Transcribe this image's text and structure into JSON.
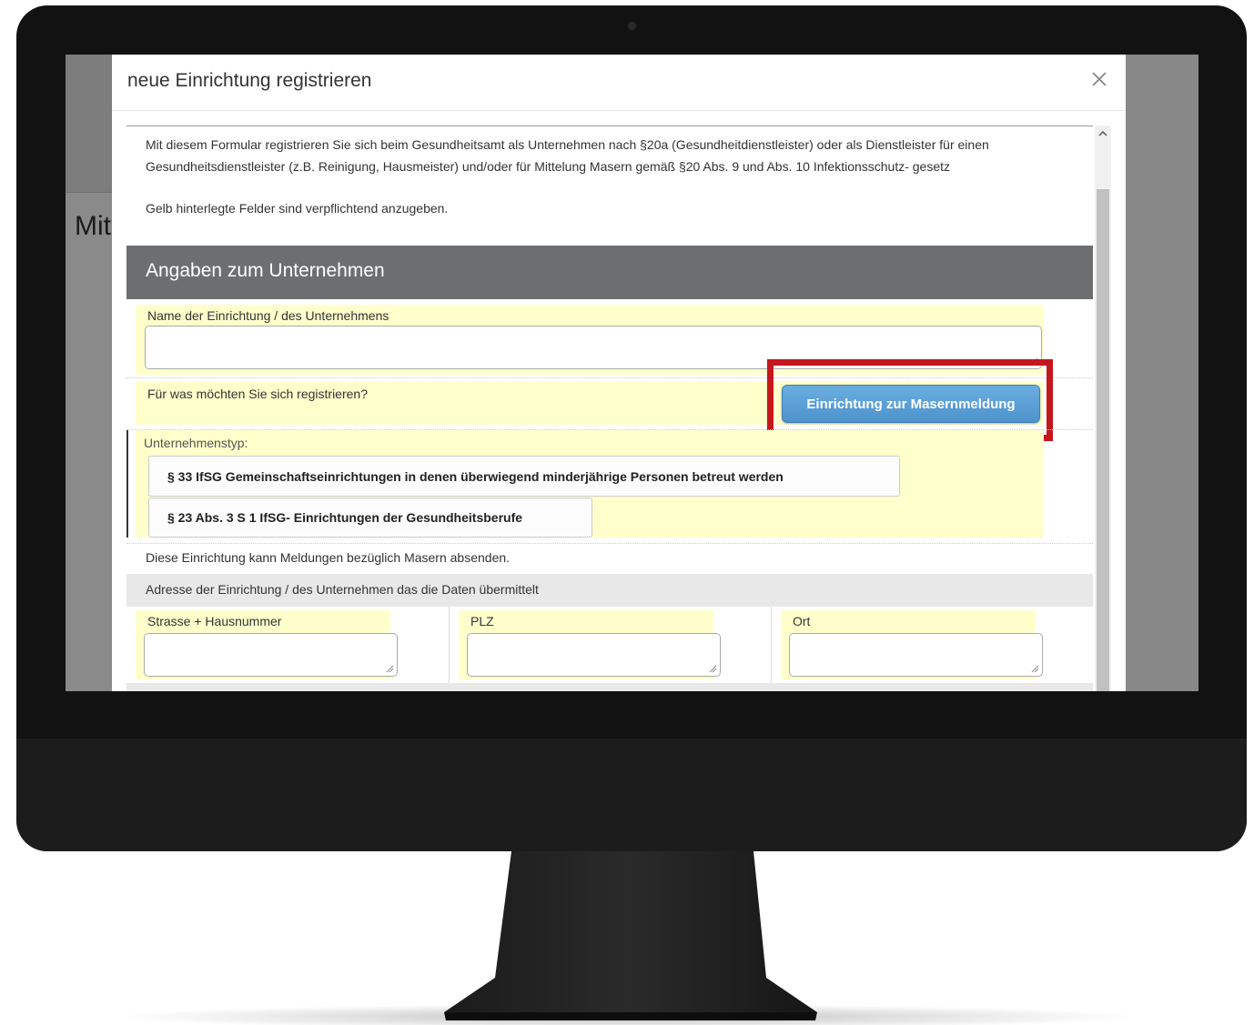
{
  "background_page": {
    "partial_title": "Mit"
  },
  "modal": {
    "title": "neue Einrichtung registrieren",
    "close_icon": "close-icon",
    "intro_text": "Mit diesem Formular registrieren Sie sich beim Gesundheitsamt als Unternehmen nach §20a (Gesundheitdienstleister) oder als Dienstleister für einen Gesundheitsdienstleister (z.B. Reinigung, Hausmeister) und/oder für Mittelung Masern gemäß §20 Abs. 9 und Abs. 10 Infektionsschutz- gesetz",
    "required_note": "Gelb hinterlegte Felder sind verpflichtend anzugeben.",
    "section_title": "Angaben zum Unternehmen",
    "name_label": "Name der Einrichtung / des Unternehmens",
    "name_value": "",
    "register_question": "Für was möchten Sie sich registrieren?",
    "masern_button": "Einrichtung zur Masernmeldung",
    "company_type_label": "Unternehmenstyp:",
    "company_types": [
      "§ 33 IfSG Gemeinschaftseinrichtungen in denen überwiegend minderjährige Personen betreut werden",
      "§ 23 Abs. 3 S 1 IfSG- Einrichtungen der Gesundheitsberufe"
    ],
    "can_send_note": "Diese Einrichtung kann Meldungen bezüglich Masern absenden.",
    "address_heading": "Adresse der Einrichtung / des Unternehmen das die Daten übermittelt",
    "address_fields": [
      {
        "label": "Strasse + Hausnummer",
        "value": ""
      },
      {
        "label": "PLZ",
        "value": ""
      },
      {
        "label": "Ort",
        "value": ""
      }
    ]
  },
  "colors": {
    "required_field_bg": "#ffffcc",
    "section_header_bg": "#6d6e70",
    "primary_button": "#5a9fd6",
    "highlight_frame": "#c5161d",
    "monitor_bezel": "#121212"
  }
}
